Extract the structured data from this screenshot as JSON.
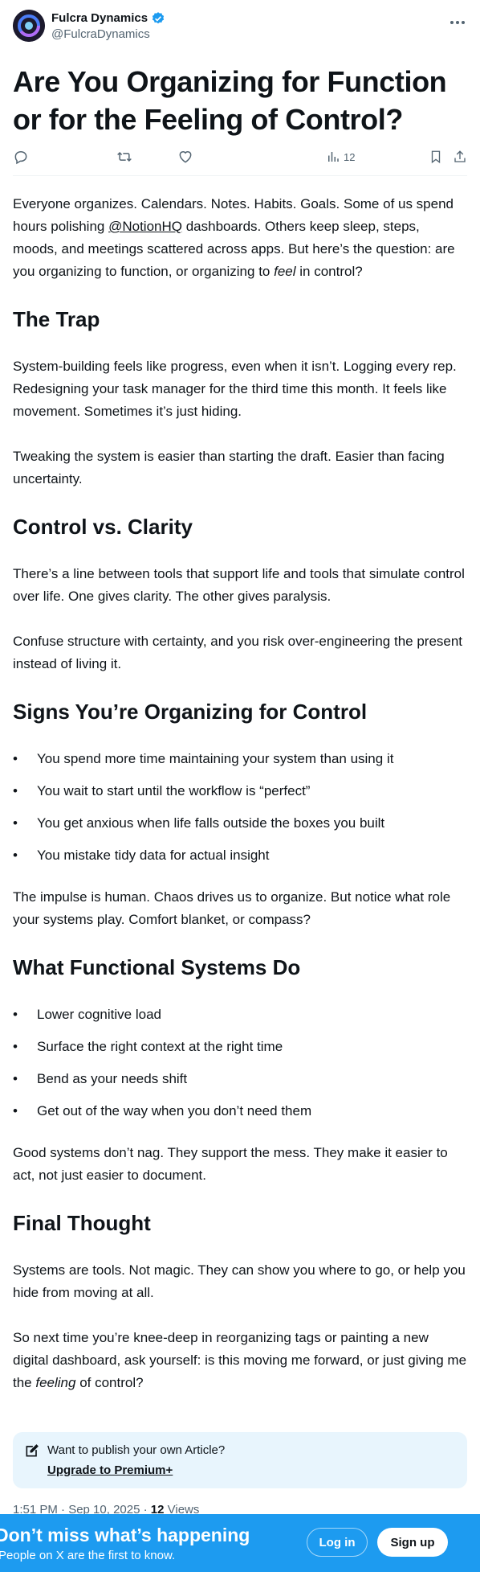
{
  "author": {
    "name": "Fulcra Dynamics",
    "handle": "@FulcraDynamics",
    "verified_color": "#1d9bf0"
  },
  "article": {
    "title": "Are You Organizing for Function or for the Feeling of Control?",
    "views_count": "12",
    "intro": {
      "a": "Everyone organizes. Calendars. Notes. Habits. Goals. Some of us spend hours polishing ",
      "mention": "@NotionHQ",
      "b": " dashboards. Others keep sleep, steps, moods, and meetings scattered across apps. But here’s the question: are you organizing to function, or organizing to ",
      "em": "feel",
      "c": " in control?"
    },
    "trap": {
      "heading": "The Trap",
      "p1": "System-building feels like progress, even when it isn’t. Logging every rep. Redesigning your task manager for the third time this month. It feels like movement. Sometimes it’s just hiding.",
      "p2": "Tweaking the system is easier than starting the draft. Easier than facing uncertainty."
    },
    "control": {
      "heading": "Control vs. Clarity",
      "p1": "There’s a line between tools that support life and tools that simulate control over life. One gives clarity. The other gives paralysis.",
      "p2": "Confuse structure with certainty, and you risk over-engineering the present instead of living it."
    },
    "signs": {
      "heading": "Signs You’re Organizing for Control",
      "items": [
        "You spend more time maintaining your system than using it",
        "You wait to start until the workflow is “perfect”",
        "You get anxious when life falls outside the boxes you built",
        "You mistake tidy data for actual insight"
      ],
      "after": "The impulse is human. Chaos drives us to organize. But notice what role your systems play. Comfort blanket, or compass?"
    },
    "functional": {
      "heading": "What Functional Systems Do",
      "items": [
        "Lower cognitive load",
        "Surface the right context at the right time",
        "Bend as your needs shift",
        "Get out of the way when you don’t need them"
      ],
      "after": "Good systems don’t nag. They support the mess. They make it easier to act, not just easier to document."
    },
    "final": {
      "heading": "Final Thought",
      "p1": "Systems are tools. Not magic. They can show you where to go, or help you hide from moving at all.",
      "p2a": "So next time you’re knee-deep in reorganizing tags or painting a new digital dashboard, ask yourself: is this moving me forward, or just giving me the ",
      "p2em": "feeling",
      "p2b": " of control?"
    }
  },
  "promo": {
    "text": "Want to publish your own Article?",
    "link": "Upgrade to Premium+"
  },
  "meta": {
    "time": "1:51 PM · Sep 10, 2025 · ",
    "views_num": "12",
    "views_label": " Views"
  },
  "banner": {
    "title": "Don’t miss what’s happening",
    "subtitle": "People on X are the first to know.",
    "login": "Log in",
    "signup": "Sign up",
    "color": "#1d9bf0"
  }
}
